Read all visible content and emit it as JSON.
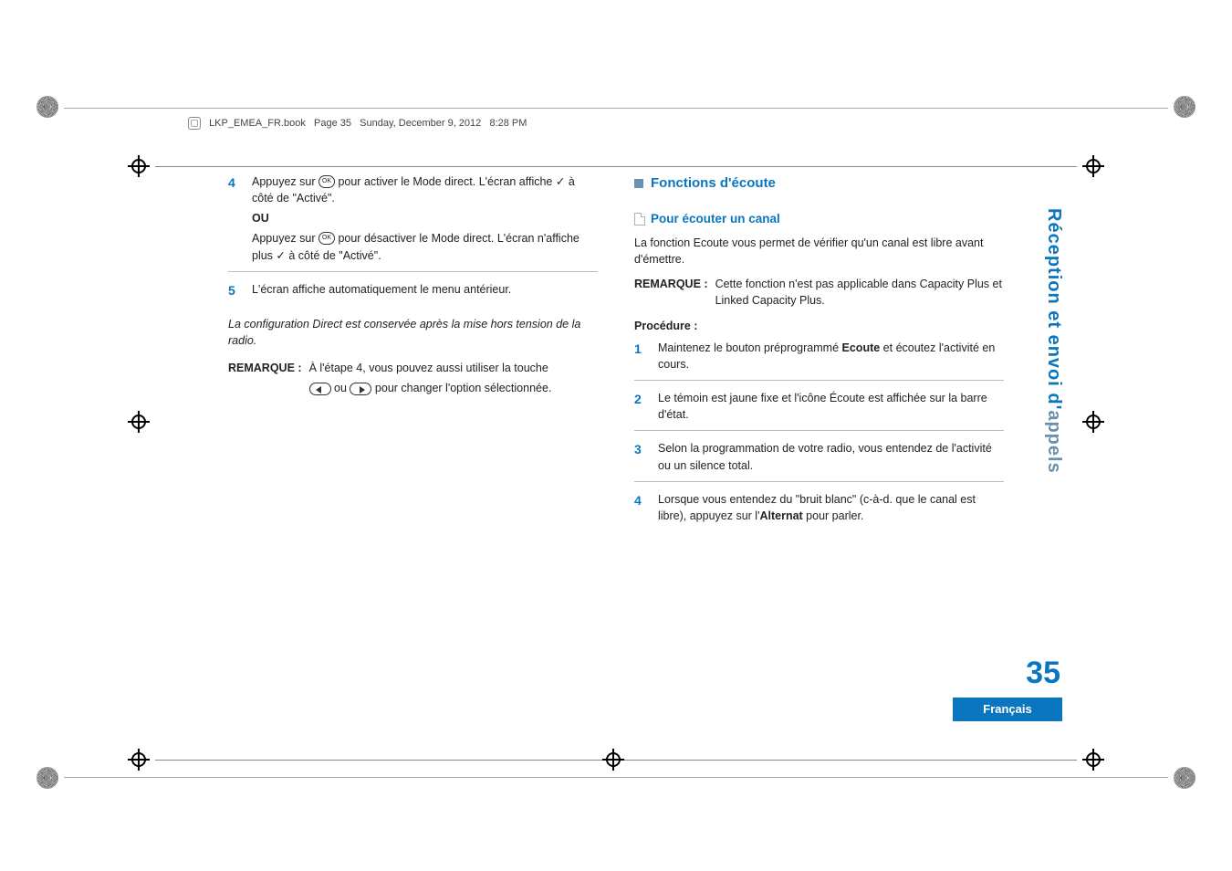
{
  "header": {
    "filename": "LKP_EMEA_FR.book",
    "page_info": "Page 35",
    "date": "Sunday, December 9, 2012",
    "time": "8:28 PM"
  },
  "left": {
    "step4": {
      "num": "4",
      "a1": "Appuyez sur ",
      "a2": " pour activer le Mode direct. L'écran affiche ",
      "a3": " à côté de \"Activé\".",
      "or": "OU",
      "b1": "Appuyez sur ",
      "b2": " pour désactiver le Mode direct. L'écran n'affiche plus ",
      "b3": " à côté de \"Activé\"."
    },
    "step5": {
      "num": "5",
      "text": "L'écran affiche automatiquement le menu antérieur."
    },
    "config_note": "La configuration Direct est conservée après la mise hors tension de la radio.",
    "remark": {
      "label": "REMARQUE :",
      "l1": "À l'étape 4, vous pouvez aussi utiliser la touche",
      "l2a": " ou ",
      "l2b": " pour changer l'option sélectionnée."
    }
  },
  "right": {
    "h_main": "Fonctions d'écoute",
    "h_sub": "Pour écouter un canal",
    "intro": "La fonction Ecoute vous permet de vérifier qu'un canal est libre avant d'émettre.",
    "remark": {
      "label": "REMARQUE :",
      "text": "Cette fonction n'est pas applicable dans Capacity Plus et Linked Capacity Plus."
    },
    "proc": "Procédure :",
    "s1": {
      "num": "1",
      "a": "Maintenez le bouton préprogrammé ",
      "b": "Ecoute",
      "c": " et écoutez l'activité en cours."
    },
    "s2": {
      "num": "2",
      "text": "Le témoin est jaune fixe et l'icône Écoute est affichée sur la barre d'état."
    },
    "s3": {
      "num": "3",
      "text": "Selon la programmation de votre radio, vous entendez de l'activité ou un silence total."
    },
    "s4": {
      "num": "4",
      "a": "Lorsque vous entendez du \"bruit blanc\" (c-à-d. que le canal est libre), appuyez sur l'",
      "b": "Alternat",
      "c": " pour parler."
    }
  },
  "sidebar": {
    "a": "Réception et envoi d'",
    "b": "appels"
  },
  "page_num": "35",
  "language": "Français",
  "ok_label": "OK",
  "check": "✓"
}
